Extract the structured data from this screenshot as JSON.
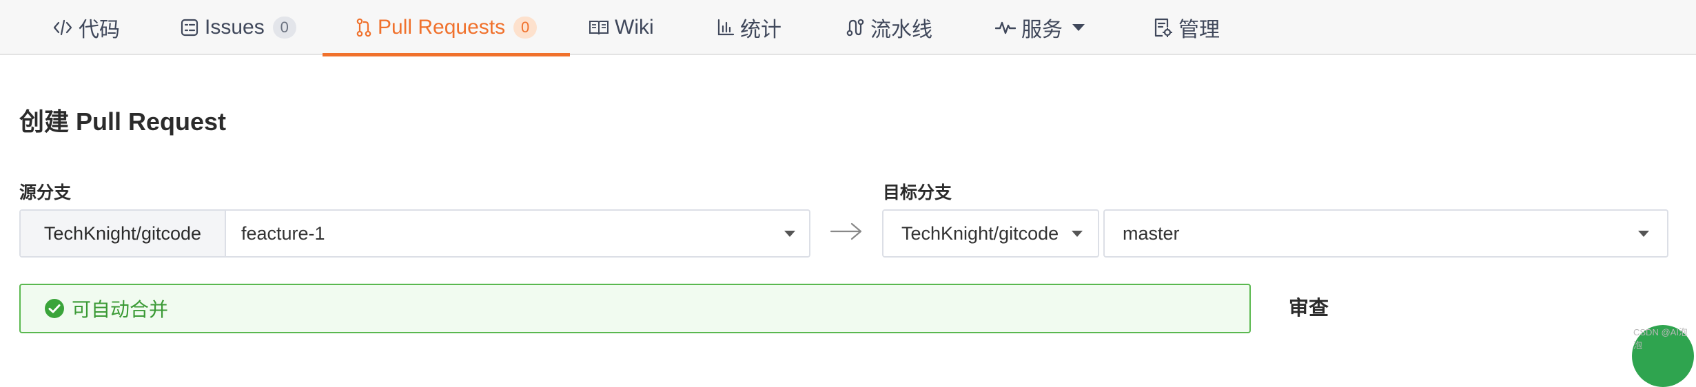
{
  "tabs": [
    {
      "key": "code",
      "label": "代码",
      "icon": "code-icon"
    },
    {
      "key": "issues",
      "label": "Issues",
      "badge": "0",
      "icon": "issues-icon"
    },
    {
      "key": "pulls",
      "label": "Pull Requests",
      "badge": "0",
      "icon": "pull-request-icon",
      "active": true
    },
    {
      "key": "wiki",
      "label": "Wiki",
      "icon": "book-icon"
    },
    {
      "key": "stats",
      "label": "统计",
      "icon": "bar-chart-icon"
    },
    {
      "key": "pipeline",
      "label": "流水线",
      "icon": "pipeline-icon"
    },
    {
      "key": "services",
      "label": "服务",
      "icon": "pulse-icon"
    },
    {
      "key": "manage",
      "label": "管理",
      "icon": "settings-doc-icon"
    }
  ],
  "page": {
    "title": "创建 Pull Request"
  },
  "source": {
    "label": "源分支",
    "repo": "TechKnight/gitcode",
    "branch": "feacture-1"
  },
  "target": {
    "label": "目标分支",
    "repo": "TechKnight/gitcode",
    "branch": "master"
  },
  "merge_status": {
    "text": "可自动合并"
  },
  "review": {
    "label": "审查"
  },
  "watermark": "CSDN @AI泡泡",
  "colors": {
    "accent": "#f0712c",
    "success": "#3a9a35",
    "success_bg": "#f1fbf0",
    "border": "#dcdfe6"
  }
}
